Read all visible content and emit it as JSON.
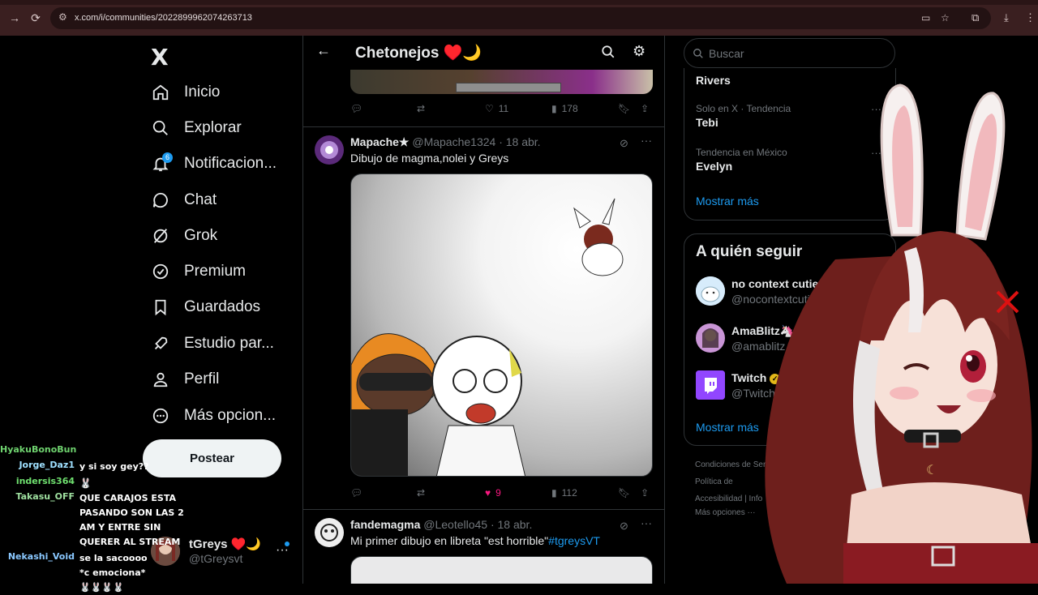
{
  "browser": {
    "url": "x.com/i/communities/2022899962074263713",
    "icons": [
      "forward-icon",
      "reload-icon",
      "tune-icon",
      "cast-icon",
      "star-icon",
      "extensions-icon",
      "download-icon",
      "profile-icon"
    ]
  },
  "nav": {
    "logo": "X",
    "items": [
      {
        "label": "Inicio",
        "icon": "home-icon"
      },
      {
        "label": "Explorar",
        "icon": "search-icon"
      },
      {
        "label": "Notificacion...",
        "icon": "bell-icon",
        "badge": "6"
      },
      {
        "label": "Chat",
        "icon": "chat-icon"
      },
      {
        "label": "Grok",
        "icon": "grok-icon"
      },
      {
        "label": "Premium",
        "icon": "verified-icon"
      },
      {
        "label": "Guardados",
        "icon": "bookmark-icon"
      },
      {
        "label": "Estudio par...",
        "icon": "rocket-icon"
      },
      {
        "label": "Perfil",
        "icon": "person-icon"
      },
      {
        "label": "Más opcion...",
        "icon": "more-circle-icon"
      }
    ],
    "post_button": "Postear",
    "account": {
      "name": "tGreys ♥️🌙",
      "handle": "@tGreysvt"
    }
  },
  "chat": [
    {
      "user": "HyakuBonoBun",
      "text": "",
      "color": "#6fd36f"
    },
    {
      "user": "Jorge_Daz1",
      "text": "y si soy gey??",
      "color": "#9fe0ff"
    },
    {
      "user": "indersis364",
      "text": "",
      "color": "#6fe06f"
    },
    {
      "user": "Takasu_OFF",
      "text": "QUE CARAJOS ESTA PASANDO SON LAS 2 AM Y ENTRE SIN QUERER AL STREAM",
      "color": "#9fe0a0"
    },
    {
      "user": "Nekashi_Void",
      "text": "se la sacoooo *c emociona* 🐰🐰🐰🐰",
      "color": "#8ac8ff"
    }
  ],
  "community": {
    "title": "Chetonejos ♥️🌙"
  },
  "posts": [
    {
      "likes": "11",
      "views": "178",
      "replies": "",
      "reposts": ""
    },
    {
      "name": "Mapache★",
      "handle": "@Mapache1324",
      "date": "· 18 abr.",
      "text": "Dibujo de magma,nolei y Greys",
      "likes": "9",
      "views": "112"
    },
    {
      "name": "fandemagma",
      "handle": "@Leotello45",
      "date": "· 18 abr.",
      "text": "Mi primer dibujo en libreta \"est horrible\"",
      "tag": "#tgreysVT"
    }
  ],
  "sidebar": {
    "search_placeholder": "Buscar",
    "trends": [
      {
        "context": "",
        "name": "Rivers"
      },
      {
        "context": "Solo en X · Tendencia",
        "name": "Tebi"
      },
      {
        "context": "Tendencia en México",
        "name": "Evelyn"
      }
    ],
    "show_more": "Mostrar más",
    "who_title": "A quién seguir",
    "who": [
      {
        "name": "no context cutie",
        "handle": "@nocontextcutie"
      },
      {
        "name": "AmaBlitz🦄",
        "handle": "@amablitz"
      },
      {
        "name": "Twitch",
        "handle": "@Twitch"
      }
    ],
    "show_more2": "Mostrar más",
    "footer": [
      "Condiciones de Servicio",
      "Política de",
      "Accesibilidad  |  Info",
      "Más opciones ···"
    ]
  }
}
